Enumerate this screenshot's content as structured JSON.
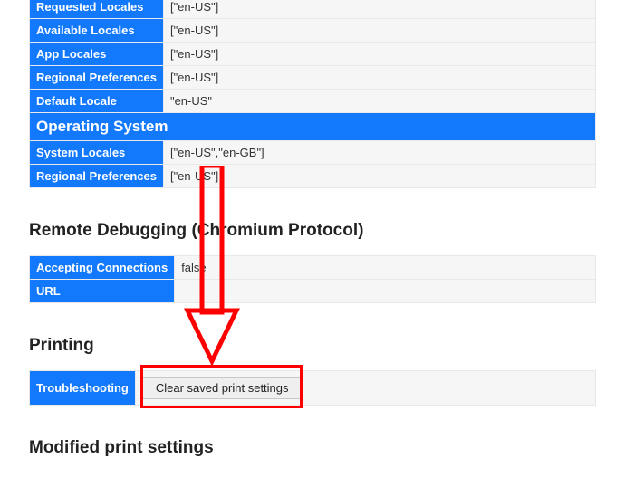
{
  "rowsTop": [
    {
      "label": "Requested Locales",
      "value": "[\"en-US\"]"
    },
    {
      "label": "Available Locales",
      "value": "[\"en-US\"]"
    },
    {
      "label": "App Locales",
      "value": "[\"en-US\"]"
    },
    {
      "label": "Regional Preferences",
      "value": "[\"en-US\"]"
    },
    {
      "label": "Default Locale",
      "value": "\"en-US\""
    }
  ],
  "osHeader": "Operating System",
  "rowsOS": [
    {
      "label": "System Locales",
      "value": "[\"en-US\",\"en-GB\"]"
    },
    {
      "label": "Regional Preferences",
      "value": "[\"en-US\"]"
    }
  ],
  "remoteDebug": {
    "title": "Remote Debugging (Chromium Protocol)",
    "rows": [
      {
        "label": "Accepting Connections",
        "value": "false"
      },
      {
        "label": "URL",
        "value": ""
      }
    ]
  },
  "printing": {
    "title": "Printing",
    "troubleshootingLabel": "Troubleshooting",
    "clearButton": "Clear saved print settings"
  },
  "modifiedTitle": "Modified print settings"
}
